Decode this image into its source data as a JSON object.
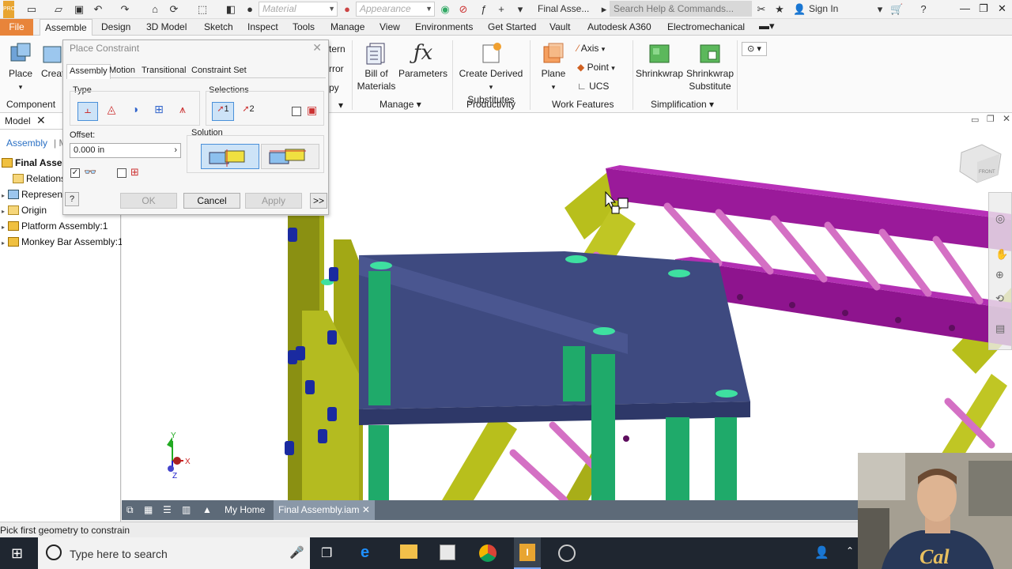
{
  "qat": {
    "material_placeholder": "Material",
    "appearance_placeholder": "Appearance",
    "title": "Final Asse...",
    "search_placeholder": "Search Help & Commands...",
    "signin": "Sign In"
  },
  "tabs": [
    "File",
    "Assemble",
    "Design",
    "3D Model",
    "Sketch",
    "Inspect",
    "Tools",
    "Manage",
    "View",
    "Environments",
    "Get Started",
    "Vault",
    "Autodesk A360",
    "Electromechanical"
  ],
  "ribbon": {
    "place": "Place",
    "create": "Creat",
    "component_group": "Component",
    "pattern": "tern",
    "mirror": "rror",
    "copy": "py",
    "bom_line1": "Bill of",
    "bom_line2": "Materials",
    "parameters": "Parameters",
    "manage_group": "Manage",
    "cds_line1": "Create Derived",
    "cds_line2": "Substitutes",
    "productivity_group": "Productivity",
    "plane": "Plane",
    "axis": "Axis",
    "point": "Point",
    "ucs": "UCS",
    "work_features_group": "Work Features",
    "shrinkwrap": "Shrinkwrap",
    "shrinkwrap_sub_line1": "Shrinkwrap",
    "shrinkwrap_sub_line2": "Substitute",
    "simplification_group": "Simplification"
  },
  "browser": {
    "tab_model": "Model",
    "tab_assembly": "Assembly",
    "tab_m": "M",
    "items": [
      "Final Assem",
      "Relations",
      "Represen",
      "Origin",
      "Platform Assembly:1",
      "Monkey Bar Assembly:1"
    ]
  },
  "dialog": {
    "title": "Place Constraint",
    "tabs": [
      "Assembly",
      "Motion",
      "Transitional",
      "Constraint Set"
    ],
    "type_label": "Type",
    "selections_label": "Selections",
    "sel1": "1",
    "sel2": "2",
    "offset_label": "Offset:",
    "offset_value": "0.000 in",
    "solution_label": "Solution",
    "ok": "OK",
    "cancel": "Cancel",
    "apply": "Apply",
    "more": ">>"
  },
  "doctabs": {
    "home": "My Home",
    "doc": "Final Assembly.iam"
  },
  "status": "Pick first geometry to constrain",
  "taskbar": {
    "search_placeholder": "Type here to search"
  },
  "viewcube": {
    "label": "FRONT"
  },
  "triad": {
    "x": "X",
    "y": "Y",
    "z": "Z"
  }
}
